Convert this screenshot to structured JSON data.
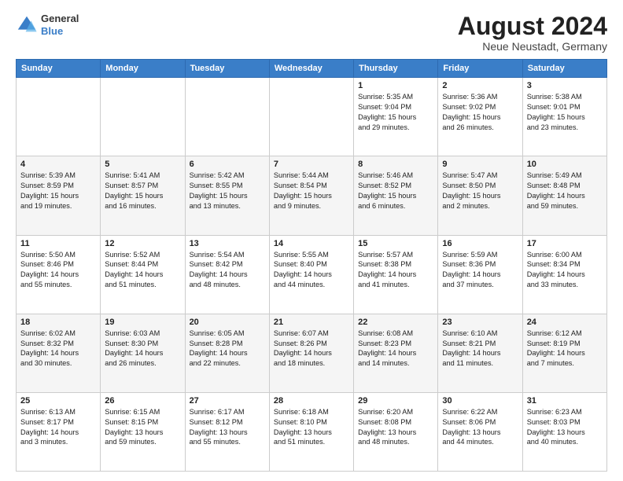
{
  "header": {
    "logo": {
      "general": "General",
      "blue": "Blue"
    },
    "title": "August 2024",
    "location": "Neue Neustadt, Germany"
  },
  "days_of_week": [
    "Sunday",
    "Monday",
    "Tuesday",
    "Wednesday",
    "Thursday",
    "Friday",
    "Saturday"
  ],
  "weeks": [
    [
      {
        "day": "",
        "info": ""
      },
      {
        "day": "",
        "info": ""
      },
      {
        "day": "",
        "info": ""
      },
      {
        "day": "",
        "info": ""
      },
      {
        "day": "1",
        "info": "Sunrise: 5:35 AM\nSunset: 9:04 PM\nDaylight: 15 hours\nand 29 minutes."
      },
      {
        "day": "2",
        "info": "Sunrise: 5:36 AM\nSunset: 9:02 PM\nDaylight: 15 hours\nand 26 minutes."
      },
      {
        "day": "3",
        "info": "Sunrise: 5:38 AM\nSunset: 9:01 PM\nDaylight: 15 hours\nand 23 minutes."
      }
    ],
    [
      {
        "day": "4",
        "info": "Sunrise: 5:39 AM\nSunset: 8:59 PM\nDaylight: 15 hours\nand 19 minutes."
      },
      {
        "day": "5",
        "info": "Sunrise: 5:41 AM\nSunset: 8:57 PM\nDaylight: 15 hours\nand 16 minutes."
      },
      {
        "day": "6",
        "info": "Sunrise: 5:42 AM\nSunset: 8:55 PM\nDaylight: 15 hours\nand 13 minutes."
      },
      {
        "day": "7",
        "info": "Sunrise: 5:44 AM\nSunset: 8:54 PM\nDaylight: 15 hours\nand 9 minutes."
      },
      {
        "day": "8",
        "info": "Sunrise: 5:46 AM\nSunset: 8:52 PM\nDaylight: 15 hours\nand 6 minutes."
      },
      {
        "day": "9",
        "info": "Sunrise: 5:47 AM\nSunset: 8:50 PM\nDaylight: 15 hours\nand 2 minutes."
      },
      {
        "day": "10",
        "info": "Sunrise: 5:49 AM\nSunset: 8:48 PM\nDaylight: 14 hours\nand 59 minutes."
      }
    ],
    [
      {
        "day": "11",
        "info": "Sunrise: 5:50 AM\nSunset: 8:46 PM\nDaylight: 14 hours\nand 55 minutes."
      },
      {
        "day": "12",
        "info": "Sunrise: 5:52 AM\nSunset: 8:44 PM\nDaylight: 14 hours\nand 51 minutes."
      },
      {
        "day": "13",
        "info": "Sunrise: 5:54 AM\nSunset: 8:42 PM\nDaylight: 14 hours\nand 48 minutes."
      },
      {
        "day": "14",
        "info": "Sunrise: 5:55 AM\nSunset: 8:40 PM\nDaylight: 14 hours\nand 44 minutes."
      },
      {
        "day": "15",
        "info": "Sunrise: 5:57 AM\nSunset: 8:38 PM\nDaylight: 14 hours\nand 41 minutes."
      },
      {
        "day": "16",
        "info": "Sunrise: 5:59 AM\nSunset: 8:36 PM\nDaylight: 14 hours\nand 37 minutes."
      },
      {
        "day": "17",
        "info": "Sunrise: 6:00 AM\nSunset: 8:34 PM\nDaylight: 14 hours\nand 33 minutes."
      }
    ],
    [
      {
        "day": "18",
        "info": "Sunrise: 6:02 AM\nSunset: 8:32 PM\nDaylight: 14 hours\nand 30 minutes."
      },
      {
        "day": "19",
        "info": "Sunrise: 6:03 AM\nSunset: 8:30 PM\nDaylight: 14 hours\nand 26 minutes."
      },
      {
        "day": "20",
        "info": "Sunrise: 6:05 AM\nSunset: 8:28 PM\nDaylight: 14 hours\nand 22 minutes."
      },
      {
        "day": "21",
        "info": "Sunrise: 6:07 AM\nSunset: 8:26 PM\nDaylight: 14 hours\nand 18 minutes."
      },
      {
        "day": "22",
        "info": "Sunrise: 6:08 AM\nSunset: 8:23 PM\nDaylight: 14 hours\nand 14 minutes."
      },
      {
        "day": "23",
        "info": "Sunrise: 6:10 AM\nSunset: 8:21 PM\nDaylight: 14 hours\nand 11 minutes."
      },
      {
        "day": "24",
        "info": "Sunrise: 6:12 AM\nSunset: 8:19 PM\nDaylight: 14 hours\nand 7 minutes."
      }
    ],
    [
      {
        "day": "25",
        "info": "Sunrise: 6:13 AM\nSunset: 8:17 PM\nDaylight: 14 hours\nand 3 minutes."
      },
      {
        "day": "26",
        "info": "Sunrise: 6:15 AM\nSunset: 8:15 PM\nDaylight: 13 hours\nand 59 minutes."
      },
      {
        "day": "27",
        "info": "Sunrise: 6:17 AM\nSunset: 8:12 PM\nDaylight: 13 hours\nand 55 minutes."
      },
      {
        "day": "28",
        "info": "Sunrise: 6:18 AM\nSunset: 8:10 PM\nDaylight: 13 hours\nand 51 minutes."
      },
      {
        "day": "29",
        "info": "Sunrise: 6:20 AM\nSunset: 8:08 PM\nDaylight: 13 hours\nand 48 minutes."
      },
      {
        "day": "30",
        "info": "Sunrise: 6:22 AM\nSunset: 8:06 PM\nDaylight: 13 hours\nand 44 minutes."
      },
      {
        "day": "31",
        "info": "Sunrise: 6:23 AM\nSunset: 8:03 PM\nDaylight: 13 hours\nand 40 minutes."
      }
    ]
  ]
}
